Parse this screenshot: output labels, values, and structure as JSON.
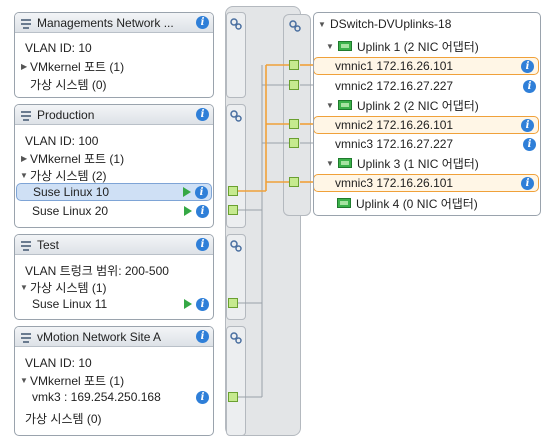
{
  "colors": {
    "accent_orange": "#f0a13a",
    "selection_blue": "#cfe0f5",
    "info_blue": "#2f7fd8",
    "port_green": "#c6ea8f"
  },
  "port_groups": [
    {
      "title": "Managements Network ...",
      "rows": [
        {
          "kind": "text",
          "label": "VLAN ID: 10"
        },
        {
          "kind": "collapsed",
          "label": "VMkernel 포트 (1)"
        },
        {
          "kind": "text",
          "label": "가상 시스템 (0)"
        }
      ]
    },
    {
      "title": "Production",
      "rows": [
        {
          "kind": "text",
          "label": "VLAN ID: 100"
        },
        {
          "kind": "collapsed",
          "label": "VMkernel 포트 (1)"
        },
        {
          "kind": "expanded",
          "label": "가상 시스템 (2)"
        },
        {
          "kind": "vm",
          "label": "Suse Linux 10",
          "selected": true
        },
        {
          "kind": "vm",
          "label": "Suse Linux 20"
        }
      ]
    },
    {
      "title": "Test",
      "rows": [
        {
          "kind": "text",
          "label": "VLAN 트렁크 범위: 200-500"
        },
        {
          "kind": "expanded",
          "label": "가상 시스템 (1)"
        },
        {
          "kind": "vm",
          "label": "Suse Linux 11"
        }
      ]
    },
    {
      "title": "vMotion Network Site A",
      "rows": [
        {
          "kind": "text",
          "label": "VLAN ID: 10"
        },
        {
          "kind": "expanded",
          "label": "VMkernel 포트 (1)"
        },
        {
          "kind": "vmk",
          "label": "vmk3 : 169.254.250.168"
        },
        {
          "kind": "text",
          "label": "가상 시스템 (0)"
        }
      ]
    }
  ],
  "uplinks": {
    "title": "DSwitch-DVUplinks-18",
    "rows": [
      {
        "kind": "uplink",
        "label": "Uplink 1 (2 NIC 어댑터)"
      },
      {
        "kind": "nic",
        "label": "vmnic1 172.16.26.101",
        "highlight": true
      },
      {
        "kind": "nic",
        "label": "vmnic2 172.16.27.227"
      },
      {
        "kind": "uplink",
        "label": "Uplink 2 (2 NIC 어댑터)"
      },
      {
        "kind": "nic",
        "label": "vmnic2 172.16.26.101",
        "highlight": true
      },
      {
        "kind": "nic",
        "label": "vmnic3 172.16.27.227"
      },
      {
        "kind": "uplink",
        "label": "Uplink 3 (1 NIC 어댑터)"
      },
      {
        "kind": "nic",
        "label": "vmnic3 172.16.26.101",
        "highlight": true
      },
      {
        "kind": "uplink-collapsed",
        "label": "Uplink 4 (0 NIC 어댑터)"
      }
    ]
  }
}
